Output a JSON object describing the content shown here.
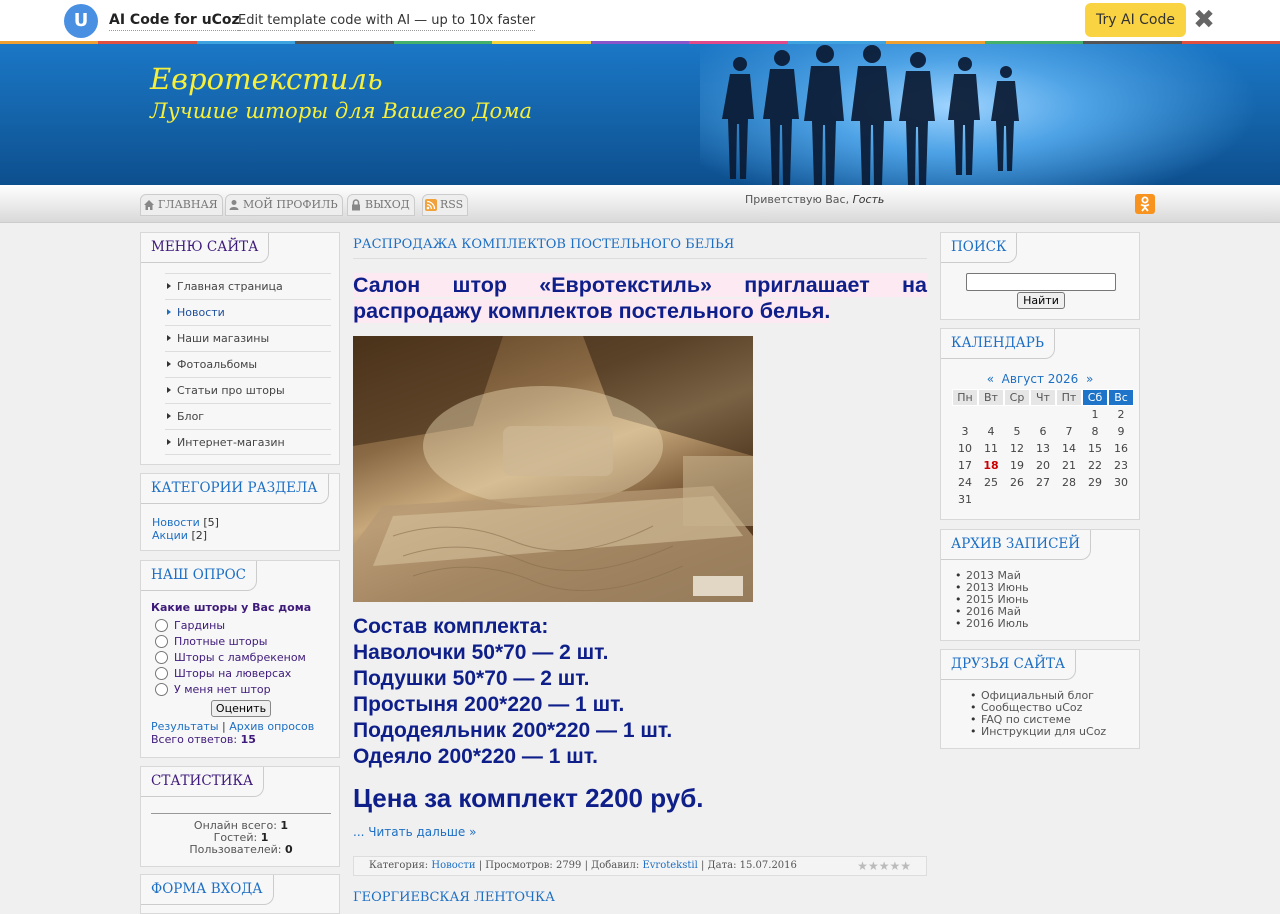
{
  "promo": {
    "logo_letter": "U",
    "brand": "AI Code for uCoz",
    "text": "Edit template code with AI — up to 10x faster",
    "button": "Try AI Code",
    "close": "✖",
    "stripe_colors": [
      "#f0a030",
      "#e05040",
      "#3fa3e0",
      "#555555",
      "#45b06a",
      "#f6d43c",
      "#8a55c8",
      "#e04a8a",
      "#3fa3e0",
      "#f0a030",
      "#45b06a",
      "#555555",
      "#e05040"
    ]
  },
  "header": {
    "title": "Евротекстиль",
    "slogan": "Лучшие шторы для Вашего Дома"
  },
  "nav": {
    "items": [
      {
        "label": "ГЛАВНАЯ",
        "icon": "home-icon"
      },
      {
        "label": "МОЙ ПРОФИЛЬ",
        "icon": "user-icon"
      },
      {
        "label": "ВЫХОД",
        "icon": "lock-icon"
      },
      {
        "label": "RSS",
        "icon": "rss-icon"
      }
    ],
    "greeting": "Приветствую Вас,",
    "guest": "Гость",
    "ok_icon": "odnoklassniki-icon"
  },
  "left": {
    "menu_title": "Меню сайта",
    "menu": [
      "Главная страница",
      "Новости",
      "Наши магазины",
      "Фотоальбомы",
      "Статьи про шторы",
      "Блог",
      "Интернет-магазин"
    ],
    "categories_title": "Категории раздела",
    "categories": [
      {
        "name": "Новости",
        "count": "[5]"
      },
      {
        "name": "Акции",
        "count": "[2]"
      }
    ],
    "poll_title": "Наш опрос",
    "poll_question": "Какие шторы у Вас дома",
    "poll_options": [
      "Гардины",
      "Плотные шторы",
      "Шторы с ламбрекеном",
      "Шторы на люверсах",
      "У меня нет штор"
    ],
    "poll_button": "Оценить",
    "poll_results": "Результаты",
    "poll_separator": "|",
    "poll_archive": "Архив опросов",
    "poll_total_label": "Всего ответов:",
    "poll_total_value": "15",
    "stats_title": "Статистика",
    "stats_online_label": "Онлайн всего:",
    "stats_online": "1",
    "stats_guests_label": "Гостей:",
    "stats_guests": "1",
    "stats_users_label": "Пользователей:",
    "stats_users": "0",
    "login_title": "Форма входа"
  },
  "post": {
    "title": "Распродажа комплектов постельного белья",
    "headline": "Салон штор «Евротекстиль» приглашает на распродажу комплектов постельного белья.",
    "composition": [
      "Состав комплекта:",
      "Наволочки 50*70 — 2 шт.",
      "Подушки 50*70 — 2 шт.",
      "Простыня 200*220 — 1 шт.",
      "Пододеяльник 200*220 — 1 шт.",
      "Одеяло 200*220 — 1 шт."
    ],
    "price": "Цена за комплект 2200 руб.",
    "read_more": "... Читать дальше »",
    "meta_category_label": "Категория:",
    "meta_category": "Новости",
    "meta_views": "| Просмотров: 2799 | Добавил:",
    "meta_author": "Evrotekstil",
    "meta_date": "| Дата: 15.07.2016",
    "rating_stars": 0,
    "next_title": "Георгиевская ленточка"
  },
  "right": {
    "search_title": "Поиск",
    "search_button": "Найти",
    "calendar_title": "Календарь",
    "calendar_prev": "«",
    "calendar_month": "Август 2026",
    "calendar_next": "»",
    "calendar_days": [
      "Пн",
      "Вт",
      "Ср",
      "Чт",
      "Пт",
      "Сб",
      "Вс"
    ],
    "calendar_weeks": [
      [
        "",
        "",
        "",
        "",
        "",
        "1",
        "2"
      ],
      [
        "3",
        "4",
        "5",
        "6",
        "7",
        "8",
        "9"
      ],
      [
        "10",
        "11",
        "12",
        "13",
        "14",
        "15",
        "16"
      ],
      [
        "17",
        "18",
        "19",
        "20",
        "21",
        "22",
        "23"
      ],
      [
        "24",
        "25",
        "26",
        "27",
        "28",
        "29",
        "30"
      ],
      [
        "31",
        "",
        "",
        "",
        "",
        "",
        ""
      ]
    ],
    "calendar_today": "18",
    "archive_title": "Архив записей",
    "archive": [
      "2013 Май",
      "2013 Июнь",
      "2015 Июнь",
      "2016 Май",
      "2016 Июль"
    ],
    "friends_title": "Друзья сайта",
    "friends": [
      "Официальный блог",
      "Сообщество uCoz",
      "FAQ по системе",
      "Инструкции для uCoz"
    ]
  }
}
